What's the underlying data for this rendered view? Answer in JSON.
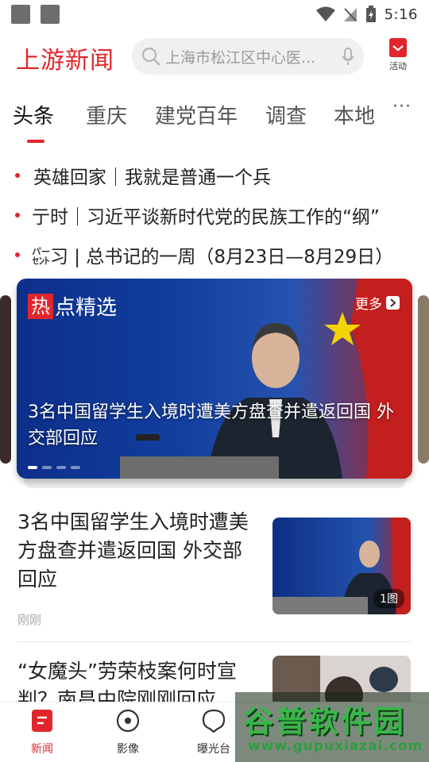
{
  "status_bar": {
    "time": "5:16"
  },
  "header": {
    "logo": "上游新闻",
    "search_placeholder": "上海市松江区中心医...",
    "activity_label": "活动"
  },
  "tabs": [
    {
      "label": "头条",
      "active": true
    },
    {
      "label": "重庆"
    },
    {
      "label": "建党百年"
    },
    {
      "label": "调查"
    },
    {
      "label": "本地"
    }
  ],
  "tabs_more": "···",
  "headlines": [
    "英雄回家｜我就是普通一个兵",
    "亍时｜习近平谈新时代党的民族工作的“纲”",
    "㌫习 | 总书记的一周（8月23日—8月29日）"
  ],
  "featured": {
    "section_badge": "热",
    "section_title": "点精选",
    "more_label": "更多",
    "title": "3名中国留学生入境时遭美方盘查并遣返回国 外交部回应",
    "slide_count": 4,
    "active_slide": 0
  },
  "news": [
    {
      "title": "3名中国留学生入境时遭美方盘查并遣返回国 外交部回应",
      "time": "刚刚",
      "image_count": "1图"
    },
    {
      "title": "“女魔头”劳荣枝案何时宣判？南昌中院刚刚回应"
    }
  ],
  "bottom_nav": [
    {
      "label": "新闻",
      "icon": "news-icon",
      "active": true
    },
    {
      "label": "影像",
      "icon": "video-icon"
    },
    {
      "label": "曝光台",
      "icon": "exposure-icon"
    }
  ],
  "watermark": {
    "title": "谷普软件园",
    "url": "www.gupuxiazai.com"
  },
  "colors": {
    "accent": "#e0262c",
    "card_blue": "#123e9e"
  }
}
